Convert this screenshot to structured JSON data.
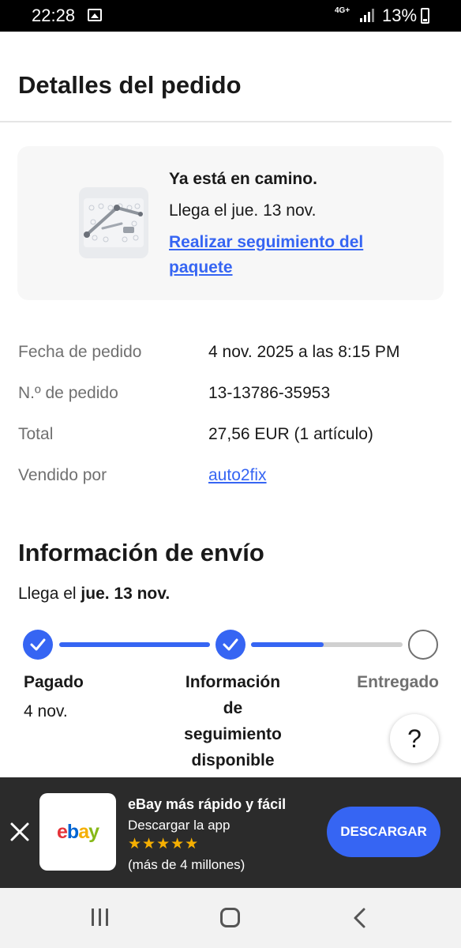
{
  "status_bar": {
    "time": "22:28",
    "network": "4G+",
    "battery": "13%"
  },
  "page": {
    "title": "Detalles del pedido"
  },
  "status_card": {
    "headline": "Ya está en camino.",
    "eta": "Llega el jue. 13 nov.",
    "track_link": "Realizar seguimiento del paquete"
  },
  "order_details": [
    {
      "label": "Fecha de pedido",
      "value": "4 nov. 2025 a las 8:15 PM"
    },
    {
      "label": "N.º de pedido",
      "value": "13-13786-35953"
    },
    {
      "label": "Total",
      "value": "27,56 EUR (1 artículo)"
    },
    {
      "label": "Vendido por",
      "value": "auto2fix"
    }
  ],
  "shipping": {
    "title": "Información de envío",
    "arrival_prefix": "Llega el",
    "arrival_date": "jue. 13 nov.",
    "steps": [
      {
        "label": "Pagado",
        "date": "4 nov."
      },
      {
        "label": "Información de seguimiento disponible"
      },
      {
        "label": "Entregado"
      }
    ],
    "progress_fraction": 0.74
  },
  "help": {
    "label": "?"
  },
  "app_banner": {
    "title": "eBay más rápido y fácil",
    "subtitle": "Descargar la app",
    "stars": "★★★★★",
    "rating_count": "(más de 4 millones)",
    "logo_letters": [
      "e",
      "b",
      "a",
      "y"
    ],
    "button": "DESCARGAR"
  },
  "colors": {
    "accent": "#3665f3",
    "star": "#f5af02",
    "logo": [
      "#e53238",
      "#0064d2",
      "#f5af02",
      "#86b817"
    ]
  },
  "icons": {
    "status": [
      "image-icon",
      "wifi-icon",
      "signal-icon",
      "battery-icon"
    ],
    "nav": [
      "recents-icon",
      "home-icon",
      "back-icon"
    ]
  }
}
